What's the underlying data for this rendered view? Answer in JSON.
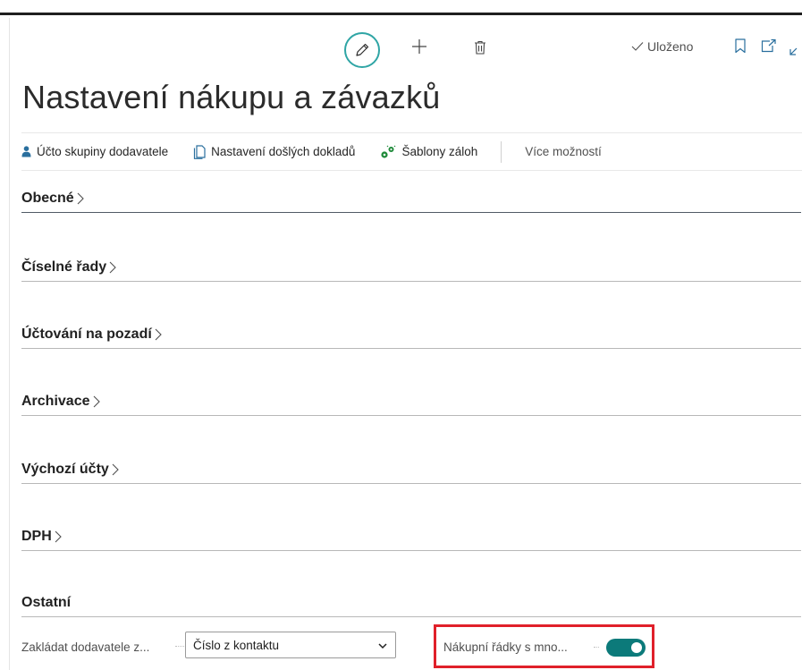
{
  "header": {
    "saved_status": "Uloženo",
    "edit_icon": "pencil-icon",
    "new_icon": "plus-icon",
    "delete_icon": "trash-icon",
    "bookmark_icon": "bookmark-icon",
    "popout_icon": "open-in-new-window-icon",
    "collapse_icon": "collapse-icon"
  },
  "page_title": "Nastavení nákupu a závazků",
  "action_bar": {
    "actions": [
      {
        "label": "Účto skupiny dodavatele",
        "icon": "person-icon"
      },
      {
        "label": "Nastavení došlých dokladů",
        "icon": "document-icon"
      },
      {
        "label": "Šablony záloh",
        "icon": "gears-icon"
      }
    ],
    "more_label": "Více možností"
  },
  "fasttabs": [
    {
      "label": "Obecné",
      "collapsed": true
    },
    {
      "label": "Číselné řady",
      "collapsed": true
    },
    {
      "label": "Účtování na pozadí",
      "collapsed": true
    },
    {
      "label": "Archivace",
      "collapsed": true
    },
    {
      "label": "Výchozí účty",
      "collapsed": true
    },
    {
      "label": "DPH",
      "collapsed": true
    },
    {
      "label": "Ostatní",
      "collapsed": false
    }
  ],
  "ostatni": {
    "create_vendor_label": "Zakládat dodavatele z...",
    "create_vendor_value": "Číslo z kontaktu",
    "purchase_lines_label": "Nákupní řádky s mno...",
    "purchase_lines_enabled": true
  },
  "colors": {
    "accent": "#2fa5a5",
    "toggle_on": "#0c7a7a",
    "highlight": "#e0202a"
  }
}
